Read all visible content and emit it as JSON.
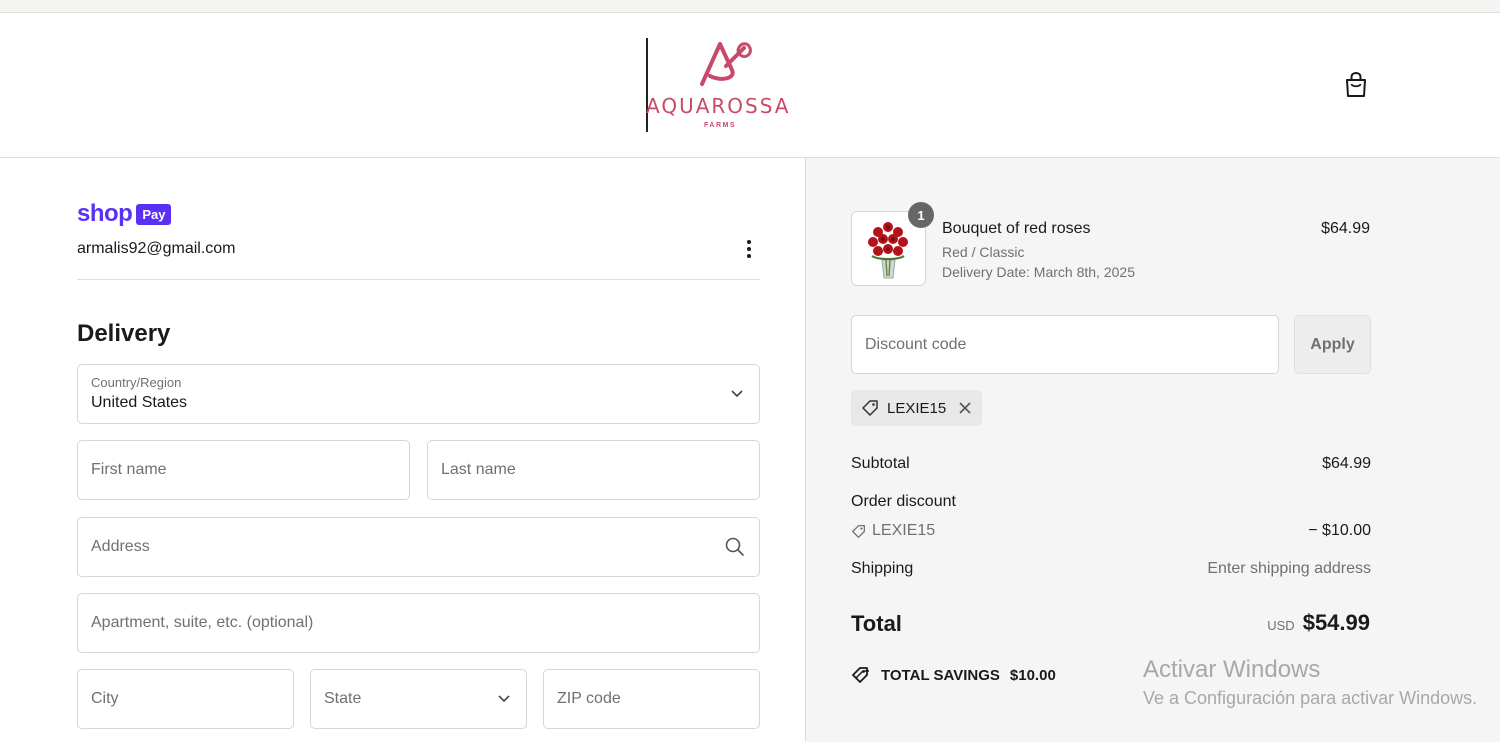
{
  "brand": {
    "name": "AQUAROSSA",
    "subtitle": "FARMS",
    "color": "#c8496a"
  },
  "header": {
    "cart_icon": "shopping-bag-icon"
  },
  "express": {
    "shop_word": "shop",
    "pay_badge": "Pay",
    "email": "armalis92@gmail.com"
  },
  "delivery": {
    "title": "Delivery",
    "country_label": "Country/Region",
    "country_value": "United States",
    "first_name_placeholder": "First name",
    "last_name_placeholder": "Last name",
    "address_placeholder": "Address",
    "apartment_placeholder": "Apartment, suite, etc. (optional)",
    "city_placeholder": "City",
    "state_placeholder": "State",
    "zip_placeholder": "ZIP code"
  },
  "order": {
    "item": {
      "quantity": "1",
      "name": "Bouquet of red roses",
      "variant": "Red / Classic",
      "delivery_date": "Delivery Date: March 8th, 2025",
      "price": "$64.99"
    },
    "discount_placeholder": "Discount code",
    "apply_label": "Apply",
    "applied_code": "LEXIE15",
    "subtotal_label": "Subtotal",
    "subtotal_value": "$64.99",
    "order_discount_label": "Order discount",
    "discount_code": "LEXIE15",
    "discount_value": "− $10.00",
    "shipping_label": "Shipping",
    "shipping_value": "Enter shipping address",
    "total_label": "Total",
    "currency": "USD",
    "total_value": "$54.99",
    "savings_label": "TOTAL SAVINGS",
    "savings_value": "$10.00"
  },
  "watermark": {
    "line1": "Activar Windows",
    "line2": "Ve a Configuración para activar Windows."
  },
  "colors": {
    "shop_pay": "#5a31f4",
    "summary_bg": "#f5f5f5"
  }
}
